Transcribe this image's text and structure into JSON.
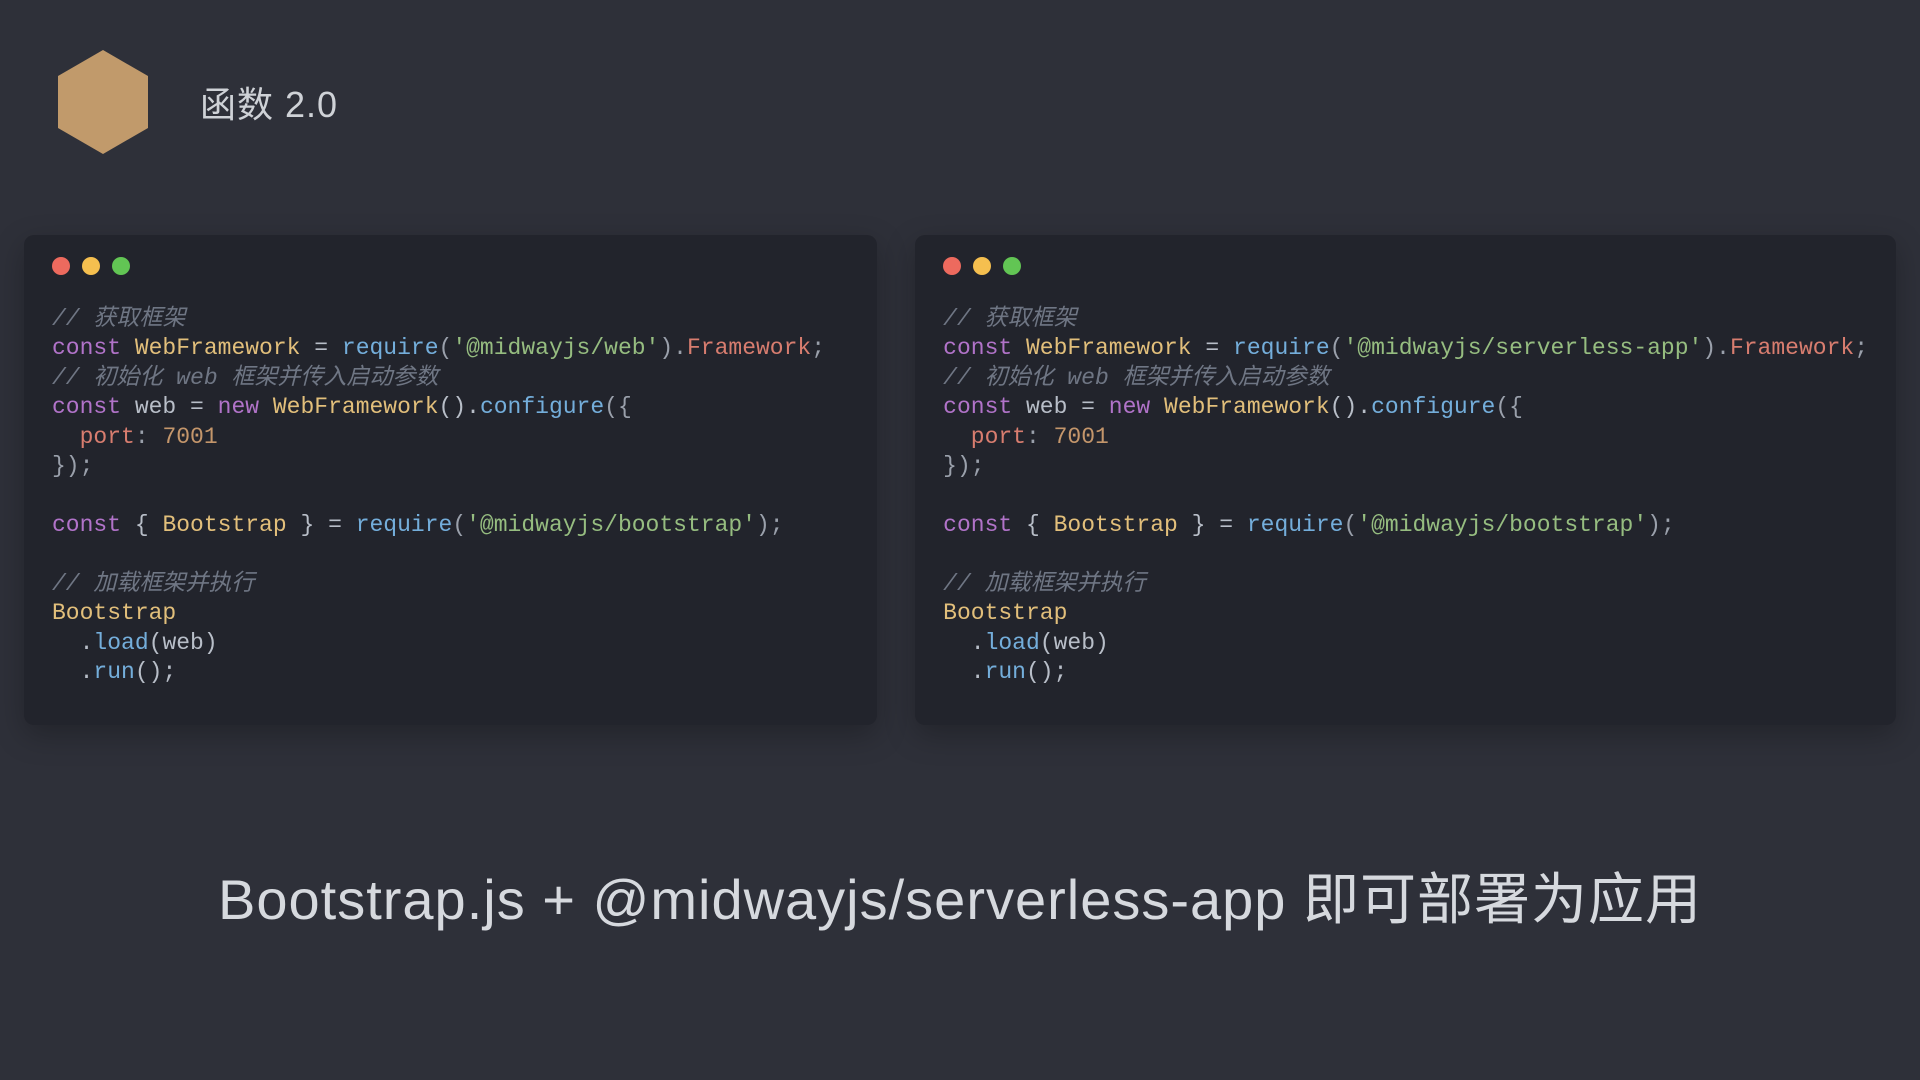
{
  "header": {
    "title": "函数 2.0",
    "hex_color": "#c19a6b"
  },
  "traffic_lights": {
    "red": "#ed6a5e",
    "yellow": "#f5bf4f",
    "green": "#62c554"
  },
  "card_left": {
    "comment1": "// 获取框架",
    "line2_kw": "const",
    "line2_class": "WebFramework",
    "line2_eq": " = ",
    "line2_req": "require",
    "line2_open": "(",
    "line2_str": "'@midwayjs/web'",
    "line2_close": ").",
    "line2_prop": "Framework",
    "line2_semi": ";",
    "comment2": "// 初始化 web 框架并传入启动参数",
    "line4_kw1": "const",
    "line4_var": " web = ",
    "line4_kw2": "new",
    "line4_sp": " ",
    "line4_class": "WebFramework",
    "line4_call": "().",
    "line4_cfg": "configure",
    "line4_open": "({",
    "line5_port": "  port",
    "line5_colon": ": ",
    "line5_num": "7001",
    "line6_close": "});",
    "blank1": "",
    "line8_kw": "const",
    "line8_open": " { ",
    "line8_class": "Bootstrap",
    "line8_close": " } = ",
    "line8_req": "require",
    "line8_popen": "(",
    "line8_str": "'@midwayjs/bootstrap'",
    "line8_pclose": ");",
    "blank2": "",
    "comment3": "// 加载框架并执行",
    "line11_class": "Bootstrap",
    "line12_dot": "  .",
    "line12_call": "load",
    "line12_arg": "(web)",
    "line13_dot": "  .",
    "line13_call": "run",
    "line13_arg": "();"
  },
  "card_right": {
    "comment1": "// 获取框架",
    "line2_kw": "const",
    "line2_class": "WebFramework",
    "line2_eq": " = ",
    "line2_req": "require",
    "line2_open": "(",
    "line2_str": "'@midwayjs/serverless-app'",
    "line2_close": ").",
    "line2_prop": "Framework",
    "line2_semi": ";",
    "comment2": "// 初始化 web 框架并传入启动参数",
    "line4_kw1": "const",
    "line4_var": " web = ",
    "line4_kw2": "new",
    "line4_sp": " ",
    "line4_class": "WebFramework",
    "line4_call": "().",
    "line4_cfg": "configure",
    "line4_open": "({",
    "line5_port": "  port",
    "line5_colon": ": ",
    "line5_num": "7001",
    "line6_close": "});",
    "blank1": "",
    "line8_kw": "const",
    "line8_open": " { ",
    "line8_class": "Bootstrap",
    "line8_close": " } = ",
    "line8_req": "require",
    "line8_popen": "(",
    "line8_str": "'@midwayjs/bootstrap'",
    "line8_pclose": ");",
    "blank2": "",
    "comment3": "// 加载框架并执行",
    "line11_class": "Bootstrap",
    "line12_dot": "  .",
    "line12_call": "load",
    "line12_arg": "(web)",
    "line13_dot": "  .",
    "line13_call": "run",
    "line13_arg": "();"
  },
  "footer": {
    "text": "Bootstrap.js + @midwayjs/serverless-app 即可部署为应用"
  }
}
